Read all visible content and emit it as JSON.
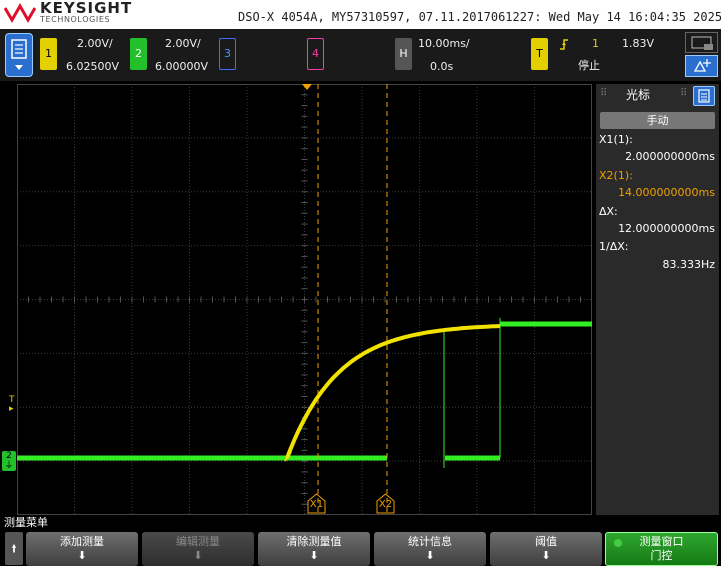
{
  "header": {
    "brand": "KEYSIGHT",
    "brand_sub": "TECHNOLOGIES",
    "device_info": "DSO-X 4054A, MY57310597, 07.11.2017061227: Wed May 14 16:04:35 2025"
  },
  "channels": {
    "ch1": {
      "number": "1",
      "scale": "2.00V/",
      "offset": "6.02500V",
      "color": "#e3d000"
    },
    "ch2": {
      "number": "2",
      "scale": "2.00V/",
      "offset": "6.00000V",
      "color": "#23c02b"
    },
    "ch3": {
      "number": "3",
      "color": "#3e6cff"
    },
    "ch4": {
      "number": "4",
      "color": "#ff3aa8"
    }
  },
  "horizontal": {
    "label": "H",
    "scale": "10.00ms/",
    "delay": "0.0s"
  },
  "trigger": {
    "label": "T",
    "source": "1",
    "level": "1.83V",
    "status": "停止",
    "slope_icon": "rising-edge-icon"
  },
  "markers": {
    "trigger_level": "T",
    "ch2_ground": "2"
  },
  "cursors": {
    "x1_tag": "X1",
    "x2_tag": "X2",
    "panel_title": "光标",
    "mode": "手动",
    "x1_label": "X1(1):",
    "x1_value": "2.000000000ms",
    "x2_label": "X2(1):",
    "x2_value": "14.000000000ms",
    "dx_label": "ΔX:",
    "dx_value": "12.000000000ms",
    "inv_dx_label": "1/ΔX:",
    "inv_dx_value": "83.333Hz"
  },
  "softkeys": {
    "menu_title": "测量菜单",
    "back_icon": "up-arrow-icon",
    "keys": [
      {
        "label": "添加测量",
        "arrow": "⬇",
        "state": "normal"
      },
      {
        "label": "编辑测量",
        "arrow": "⬇",
        "state": "disabled"
      },
      {
        "label": "清除测量值",
        "arrow": "⬇",
        "state": "normal"
      },
      {
        "label": "统计信息",
        "arrow": "⬇",
        "state": "normal"
      },
      {
        "label": "阈值",
        "arrow": "⬇",
        "state": "normal"
      },
      {
        "label": "测量窗口",
        "sub": "门控",
        "state": "active"
      }
    ]
  },
  "colors": {
    "ch1_trace": "#f2e200",
    "ch2_trace": "#33ee22",
    "cursor": "#f0a000",
    "grid": "#3a3a3a",
    "panel_bg": "#2a2a2a",
    "accent": "#2a6fd0"
  }
}
